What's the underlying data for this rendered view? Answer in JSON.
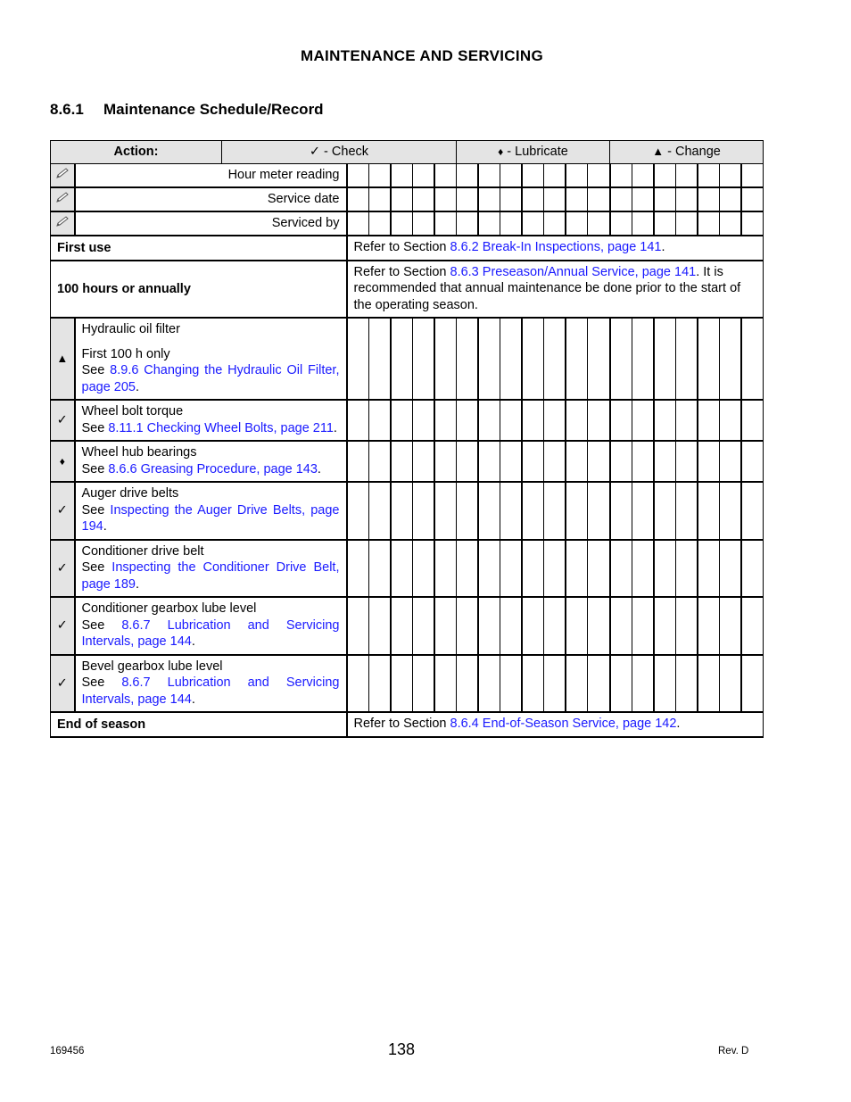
{
  "section_header": "MAINTENANCE AND SERVICING",
  "page_title": {
    "number": "8.6.1",
    "text": "Maintenance Schedule/Record"
  },
  "legend": {
    "action_label": "Action:",
    "check": {
      "symbol": "✓",
      "label": " - Check"
    },
    "lubricate": {
      "symbol": "♦",
      "label": " - Lubricate"
    },
    "change": {
      "symbol": "▲",
      "label": " - Change"
    }
  },
  "record_rows": [
    {
      "icon": "pencil-icon",
      "label": "Hour meter reading"
    },
    {
      "icon": "pencil-icon",
      "label": "Service date"
    },
    {
      "icon": "pencil-icon",
      "label": "Serviced by"
    }
  ],
  "grid_columns": 19,
  "intervals": {
    "first_use": {
      "label": "First use",
      "prefix": "Refer to Section ",
      "link": "8.6.2 Break-In Inspections, page 141",
      "suffix": "."
    },
    "hundred_hours": {
      "label": "100 hours or annually",
      "prefix": "Refer to Section ",
      "link": "8.6.3 Preseason/Annual Service, page 141",
      "suffix": ". It is recommended that annual maintenance be done prior to the start of the operating season."
    },
    "end_of_season": {
      "label": "End of season",
      "prefix": "Refer to Section ",
      "link": "8.6.4 End-of-Season Service, page 142",
      "suffix": "."
    }
  },
  "tasks": [
    {
      "action": "change",
      "symbol": "▲",
      "name": "Hydraulic oil filter",
      "note": "First 100 h only",
      "see": "See ",
      "link": "8.9.6 Changing the Hydraulic Oil Filter, page 205",
      "suffix": "."
    },
    {
      "action": "check",
      "symbol": "✓",
      "name": "Wheel bolt torque",
      "note": "",
      "see": "See ",
      "link": "8.11.1 Checking Wheel Bolts, page 211",
      "suffix": "."
    },
    {
      "action": "lubricate",
      "symbol": "♦",
      "name": "Wheel hub bearings",
      "note": "",
      "see": "See ",
      "link": "8.6.6 Greasing Procedure, page 143",
      "suffix": "."
    },
    {
      "action": "check",
      "symbol": "✓",
      "name": "Auger drive belts",
      "note": "",
      "see": "See ",
      "link": "Inspecting the Auger Drive Belts, page 194",
      "suffix": "."
    },
    {
      "action": "check",
      "symbol": "✓",
      "name": "Conditioner drive belt",
      "note": "",
      "see": "See ",
      "link": "Inspecting the Conditioner Drive Belt, page 189",
      "suffix": "."
    },
    {
      "action": "check",
      "symbol": "✓",
      "name": "Conditioner gearbox lube level",
      "note": "",
      "see": "See ",
      "link": "8.6.7 Lubrication and Servicing Intervals, page 144",
      "suffix": "."
    },
    {
      "action": "check",
      "symbol": "✓",
      "name": "Bevel gearbox lube level",
      "note": "",
      "see": "See ",
      "link": "8.6.7 Lubrication and Servicing Intervals, page 144",
      "suffix": "."
    }
  ],
  "colors": {
    "link": "#1a1aff",
    "header_bg": "#e4e4e4"
  },
  "footer": {
    "doc_number": "169456",
    "page_number": "138",
    "revision": "Rev. D"
  }
}
